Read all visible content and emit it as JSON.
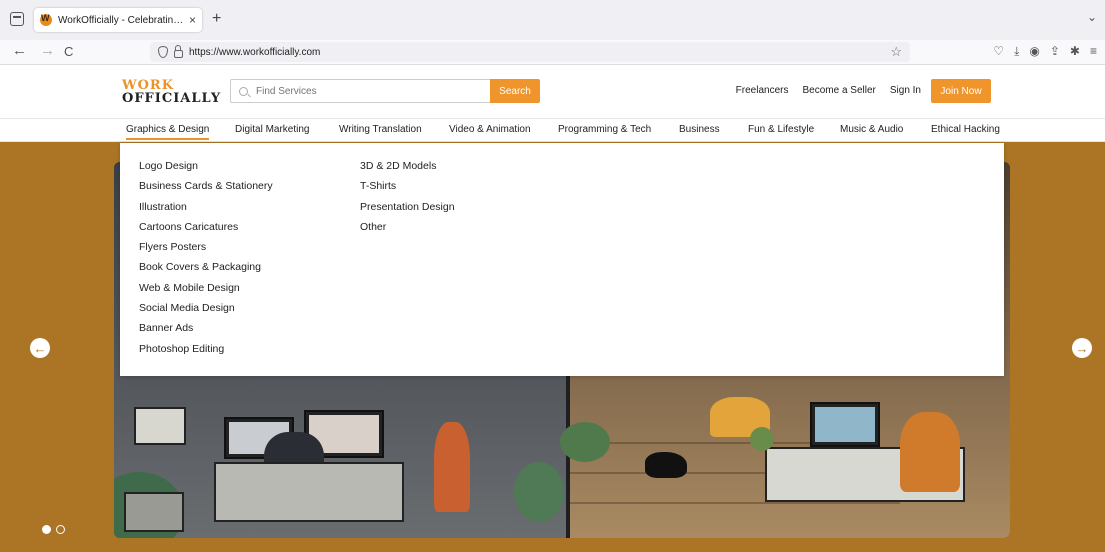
{
  "browser": {
    "tab_title": "WorkOfficially - Celebrating Eve",
    "tab_close": "×",
    "new_tab": "+",
    "url": "https://www.workofficially.com",
    "nav_back": "←",
    "nav_forward": "→",
    "nav_reload": "C",
    "bookmark_star": "☆",
    "overflow_chevron": "⌄",
    "tool_icons": [
      "pocket-icon",
      "download-icon",
      "account-icon",
      "share-icon",
      "extensions-icon",
      "menu-icon"
    ]
  },
  "header": {
    "logo_line1": "WORK",
    "logo_line2": "OFFICIALLY",
    "search_placeholder": "Find Services",
    "search_button": "Search",
    "links": [
      "Freelancers",
      "Become a Seller",
      "Sign In"
    ],
    "join_button": "Join Now"
  },
  "categories": [
    {
      "label": "Graphics & Design",
      "active": true
    },
    {
      "label": "Digital Marketing"
    },
    {
      "label": "Writing Translation"
    },
    {
      "label": "Video & Animation"
    },
    {
      "label": "Programming & Tech"
    },
    {
      "label": "Business"
    },
    {
      "label": "Fun & Lifestyle"
    },
    {
      "label": "Music & Audio"
    },
    {
      "label": "Ethical Hacking"
    }
  ],
  "dropdown": {
    "col1": [
      "Logo Design",
      "Business Cards & Stationery",
      "Illustration",
      "Cartoons Caricatures",
      "Flyers Posters",
      "Book Covers & Packaging",
      "Web & Mobile Design",
      "Social Media Design",
      "Banner Ads",
      "Photoshop Editing"
    ],
    "col2": [
      "3D & 2D Models",
      "T-Shirts",
      "Presentation Design",
      "Other"
    ]
  },
  "hero": {
    "prev_arrow": "←",
    "next_arrow": "→",
    "slides": 2,
    "active_slide": 1
  },
  "colors": {
    "accent": "#f0952c",
    "hero_bg": "#ab7525"
  }
}
